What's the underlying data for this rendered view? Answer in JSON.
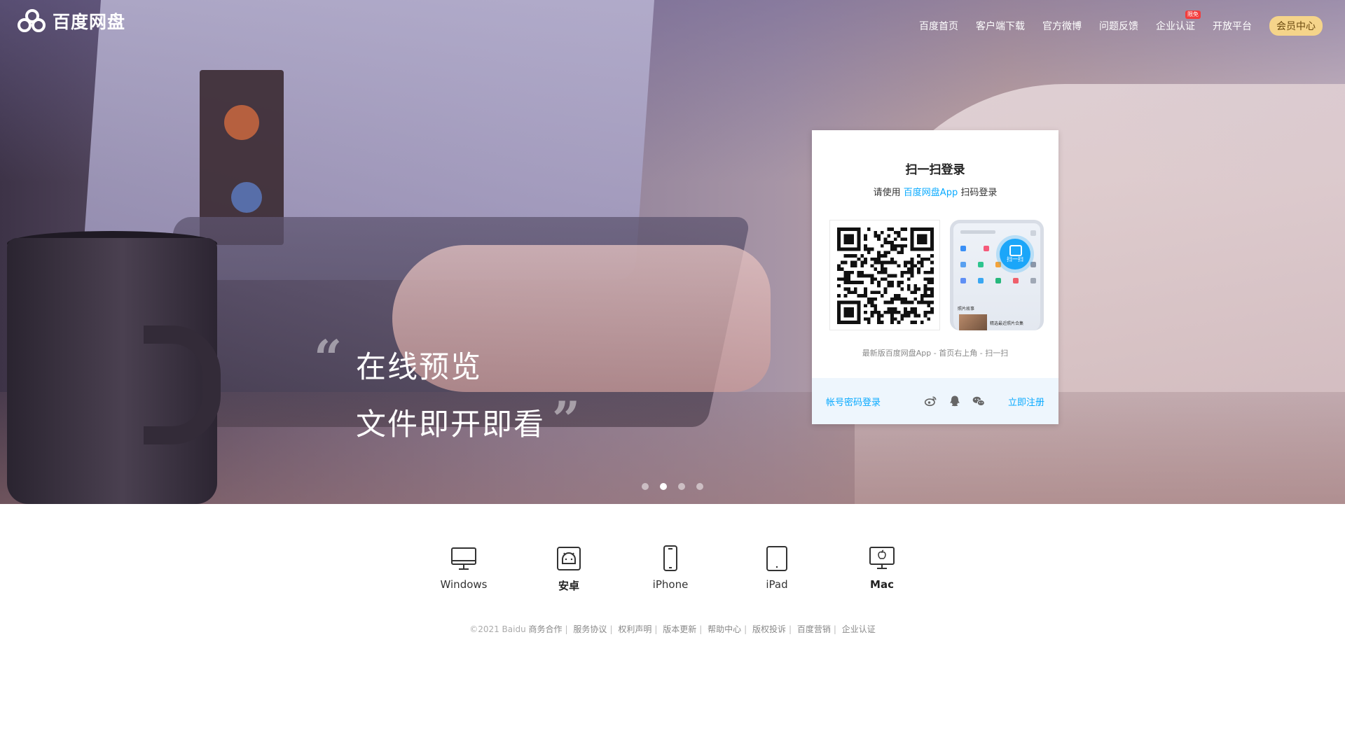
{
  "brand": {
    "name": "百度网盘"
  },
  "nav": {
    "items": [
      {
        "label": "百度首页"
      },
      {
        "label": "客户端下载"
      },
      {
        "label": "官方微博"
      },
      {
        "label": "问题反馈"
      },
      {
        "label": "企业认证",
        "badge": "限免"
      },
      {
        "label": "开放平台"
      }
    ],
    "vip": "会员中心"
  },
  "hero": {
    "line1": "在线预览",
    "line2": "文件即开即看",
    "quote_open": "“",
    "quote_close": "”",
    "carousel": {
      "count": 4,
      "active_index": 1
    }
  },
  "login": {
    "title": "扫一扫登录",
    "sub_prefix": "请使用",
    "sub_app": "百度网盘App",
    "sub_suffix": "扫码登录",
    "phone_scan": "扫一扫",
    "phone_text1": "照片故事",
    "phone_text2": "精选最近照片合集",
    "hint": "最新版百度网盘App - 首页右上角 - 扫一扫",
    "account_login": "帐号密码登录",
    "register": "立即注册",
    "social": [
      "weibo-icon",
      "qq-icon",
      "wechat-icon"
    ]
  },
  "platforms": [
    {
      "label": "Windows",
      "icon": "monitor-icon"
    },
    {
      "label": "安卓",
      "icon": "android-icon"
    },
    {
      "label": "iPhone",
      "icon": "iphone-icon"
    },
    {
      "label": "iPad",
      "icon": "ipad-icon"
    },
    {
      "label": "Mac",
      "icon": "mac-icon"
    }
  ],
  "footer": {
    "copyright": "©2021 Baidu",
    "links": [
      "商务合作",
      "服务协议",
      "权利声明",
      "版本更新",
      "帮助中心",
      "版权投诉",
      "百度营销",
      "企业认证"
    ]
  },
  "colors": {
    "accent": "#09aaff",
    "vip_bg": "#f5d48a"
  }
}
